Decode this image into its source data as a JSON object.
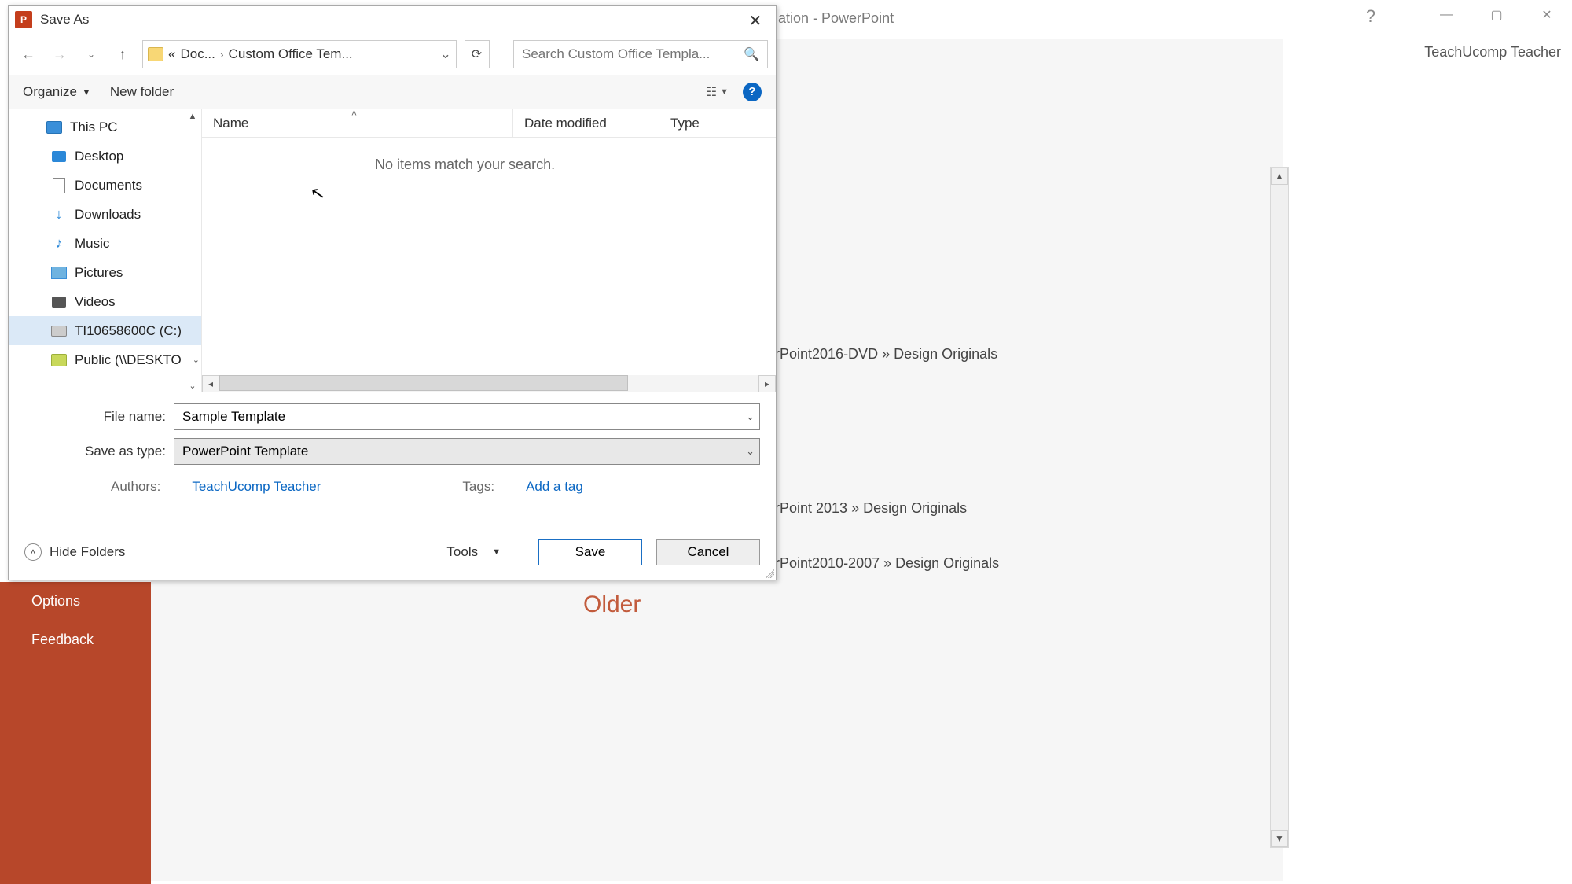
{
  "powerpoint": {
    "title_suffix": "ation - PowerPoint",
    "user": "TeachUcomp Teacher",
    "sidebar": {
      "options": "Options",
      "feedback": "Feedback"
    },
    "paths": {
      "p1": "rPoint2016-DVD » Design Originals",
      "p2": "rPoint 2013 » Design Originals",
      "p3": "rPoint2010-2007 » Design Originals"
    },
    "older": "Older"
  },
  "dialog": {
    "title": "Save As",
    "breadcrumb": {
      "seg1": "Doc...",
      "seg2": "Custom Office Tem...",
      "chevrons": "«"
    },
    "search_placeholder": "Search Custom Office Templa...",
    "toolbar": {
      "organize": "Organize",
      "newfolder": "New folder"
    },
    "columns": {
      "name": "Name",
      "date": "Date modified",
      "type": "Type"
    },
    "empty_msg": "No items match your search.",
    "tree": {
      "thispc": "This PC",
      "desktop": "Desktop",
      "documents": "Documents",
      "downloads": "Downloads",
      "music": "Music",
      "pictures": "Pictures",
      "videos": "Videos",
      "cdrive": "TI10658600C (C:)",
      "netshare": "Public (\\\\DESKTO"
    },
    "fields": {
      "filename_label": "File name:",
      "filename_value": "Sample Template",
      "savetype_label": "Save as type:",
      "savetype_value": "PowerPoint Template",
      "authors_label": "Authors:",
      "authors_value": "TeachUcomp Teacher",
      "tags_label": "Tags:",
      "tags_value": "Add a tag"
    },
    "footer": {
      "hidefolders": "Hide Folders",
      "tools": "Tools",
      "save": "Save",
      "cancel": "Cancel"
    }
  }
}
